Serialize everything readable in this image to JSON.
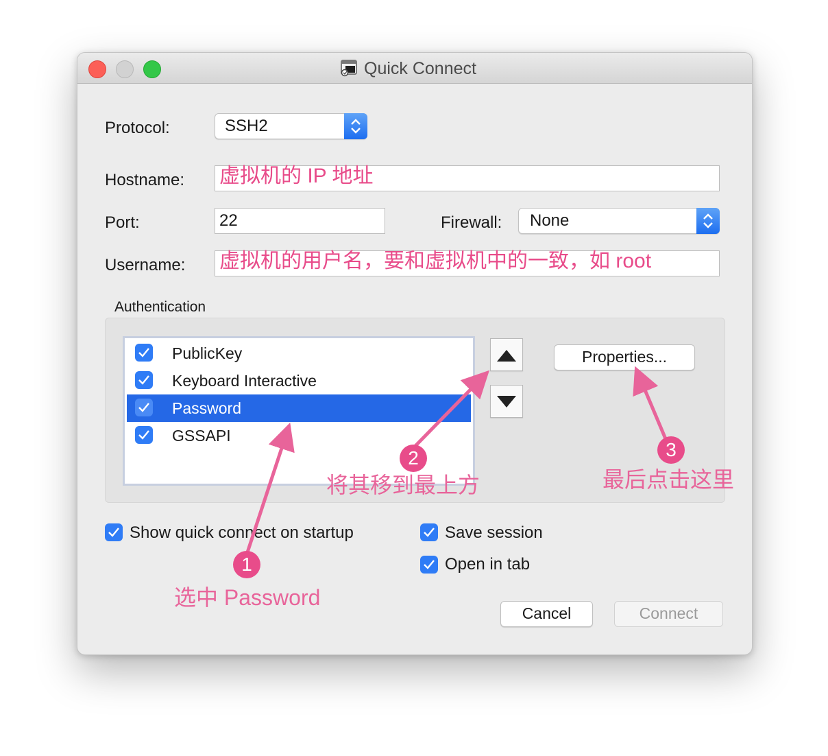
{
  "window": {
    "title": "Quick Connect"
  },
  "form": {
    "protocol_label": "Protocol:",
    "protocol_value": "SSH2",
    "hostname_label": "Hostname:",
    "hostname_value": "虚拟机的 IP 地址",
    "port_label": "Port:",
    "port_value": "22",
    "firewall_label": "Firewall:",
    "firewall_value": "None",
    "username_label": "Username:",
    "username_value": "虚拟机的用户名，要和虚拟机中的一致，如 root"
  },
  "auth": {
    "label": "Authentication",
    "items": [
      {
        "label": "PublicKey",
        "checked": true,
        "selected": false
      },
      {
        "label": "Keyboard Interactive",
        "checked": true,
        "selected": false
      },
      {
        "label": "Password",
        "checked": true,
        "selected": true
      },
      {
        "label": "GSSAPI",
        "checked": true,
        "selected": false
      }
    ],
    "properties_label": "Properties..."
  },
  "options": {
    "show_quick_connect": "Show quick connect on startup",
    "save_session": "Save session",
    "open_in_tab": "Open in tab"
  },
  "buttons": {
    "cancel": "Cancel",
    "connect": "Connect"
  },
  "annotations": {
    "step1_num": "1",
    "step1_text": "选中 Password",
    "step2_num": "2",
    "step2_text": "将其移到最上方",
    "step3_num": "3",
    "step3_text": "最后点击这里"
  },
  "colors": {
    "accent": "#2f7cf6",
    "selection": "#2568e6",
    "annotation": "#e84c8a"
  }
}
